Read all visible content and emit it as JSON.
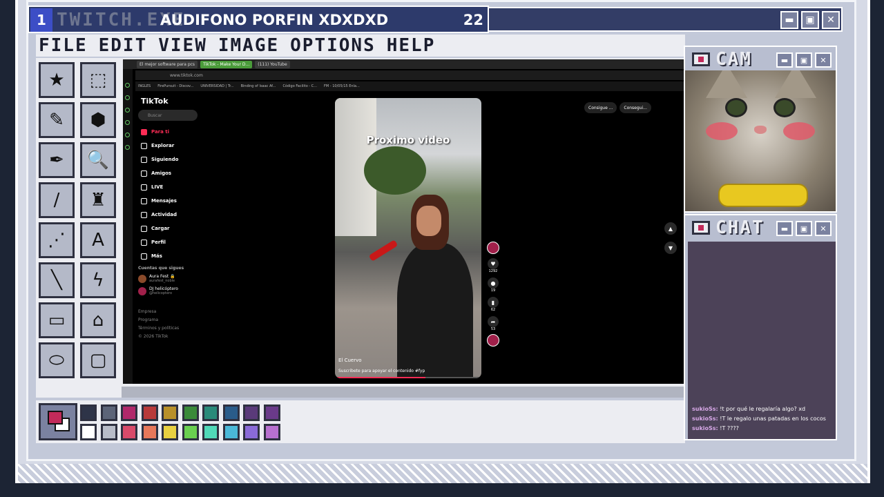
{
  "window": {
    "channel_number": "1",
    "logo_text": "TWITCH.EXE",
    "title": "AUDIFONO PORFIN XDXDXD",
    "count": "22",
    "min_glyph": "▬",
    "max_glyph": "▣",
    "close_glyph": "✕"
  },
  "menu": [
    "FILE",
    "EDIT",
    "VIEW",
    "IMAGE",
    "OPTIONS",
    "HELP"
  ],
  "tools": [
    "★",
    "⬚",
    "✎",
    "⬢",
    "✒",
    "🔍",
    "/",
    "♜",
    "⋰",
    "A",
    "╲",
    "ϟ",
    "▭",
    "⌂",
    "⬭",
    "▢"
  ],
  "browser": {
    "tabs": [
      "El mejor software para pcs",
      "TikTok - Make Your D...",
      "(111) YouTube"
    ],
    "url": "www.tiktok.com",
    "bookmarks": [
      "INGLES",
      "FirePursuit - Discov...",
      "UNIVERSIDAD | Tr...",
      "Binding of Isaac Af...",
      "Código Facilito - C...",
      "FM - 10/05/15 Enla..."
    ]
  },
  "tiktok": {
    "logo": "TikTok",
    "search_placeholder": "Buscar",
    "nav": [
      "Para ti",
      "Explorar",
      "Siguiendo",
      "Amigos",
      "LIVE",
      "Mensajes",
      "Actividad",
      "Cargar",
      "Perfil",
      "Más"
    ],
    "following_title": "Cuentas que sigues",
    "following": [
      {
        "name": "Aura Fest 🔒",
        "handle": "aurafest_noble"
      },
      {
        "name": "DJ helicóptero",
        "handle": "@helicoptero"
      }
    ],
    "footer": [
      "Empresa",
      "Programa",
      "Términos y políticas",
      "© 2026 TikTok"
    ],
    "top_buttons": [
      "Consigue ...",
      "Consegui..."
    ],
    "video": {
      "caption": "Proximo video",
      "author": "El Cuervo",
      "description": "Suscribete para apoyar el contenido #fyp",
      "progress": 0.62
    },
    "actions": {
      "likes": "1292",
      "comments": "19",
      "saves": "62",
      "shares": "53"
    }
  },
  "palette": {
    "current_fg": "#c22a5a",
    "current_bg": "#ffffff",
    "row1": [
      "#2e3448",
      "#5c6478",
      "#b0286a",
      "#b83a3a",
      "#b8902a",
      "#3a8a3a",
      "#2a8a7a",
      "#2a5c8a",
      "#5a3a7a",
      "#6a3a8a"
    ],
    "row2": [
      "#ffffff",
      "#b8bcc8",
      "#d84a6a",
      "#e8785a",
      "#e8d040",
      "#6ad050",
      "#50d8b8",
      "#4ab8d8",
      "#8a6ad8",
      "#b870d0"
    ]
  },
  "cam": {
    "title": "CAM"
  },
  "chat": {
    "title": "CHAT",
    "messages": [
      {
        "user": "sukioSs:",
        "text": "!t por qué le regalaría algo? xd"
      },
      {
        "user": "sukioSs:",
        "text": "!T le regalo unas patadas en los cocos"
      },
      {
        "user": "sukioSs:",
        "text": "!T ????"
      }
    ]
  }
}
